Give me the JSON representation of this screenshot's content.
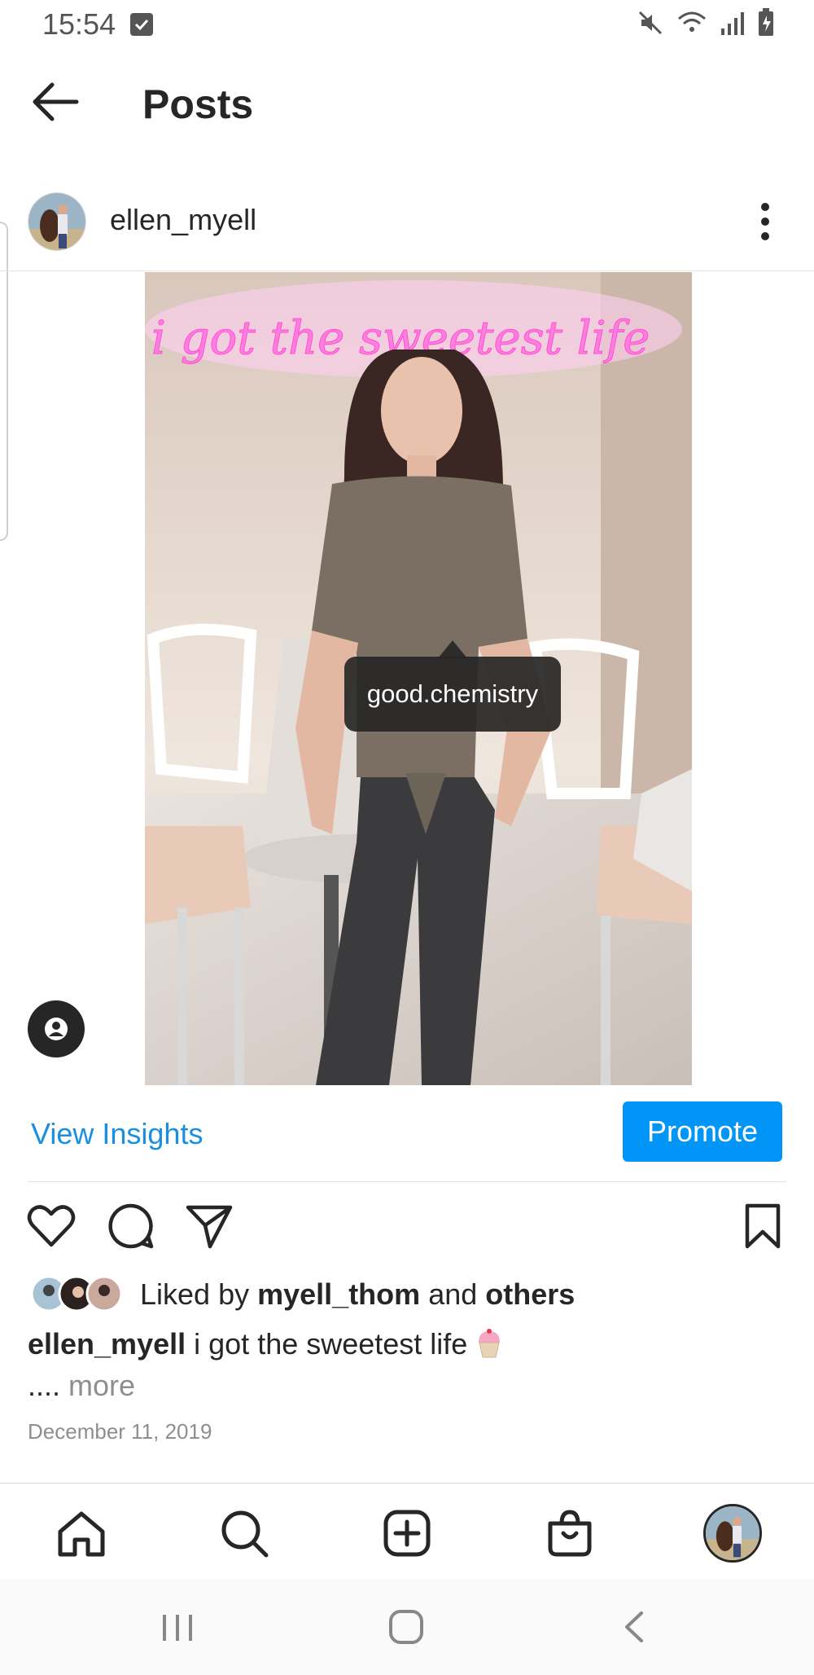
{
  "status_bar": {
    "time": "15:54"
  },
  "header": {
    "title": "Posts"
  },
  "post": {
    "username": "ellen_myell",
    "image_text": "i got the sweetest life",
    "tag_label": "good.chemistry",
    "view_insights": "View Insights",
    "promote": "Promote",
    "liked_prefix": "Liked by",
    "liked_user": "myell_thom",
    "liked_and": "and",
    "liked_others": "others",
    "caption_user": "ellen_myell",
    "caption_text": "i got the sweetest life",
    "more_prefix": "....",
    "more_label": "more",
    "date": "December 11, 2019"
  },
  "colors": {
    "link_blue": "#1a8fe0",
    "promote_blue": "#0095f6",
    "text": "#262626",
    "muted": "#8e8e8e"
  },
  "icons": [
    "back-arrow-icon",
    "more-vertical-icon",
    "user-tag-icon",
    "heart-icon",
    "comment-icon",
    "share-icon",
    "bookmark-icon",
    "home-icon",
    "search-icon",
    "add-post-icon",
    "shop-icon"
  ]
}
